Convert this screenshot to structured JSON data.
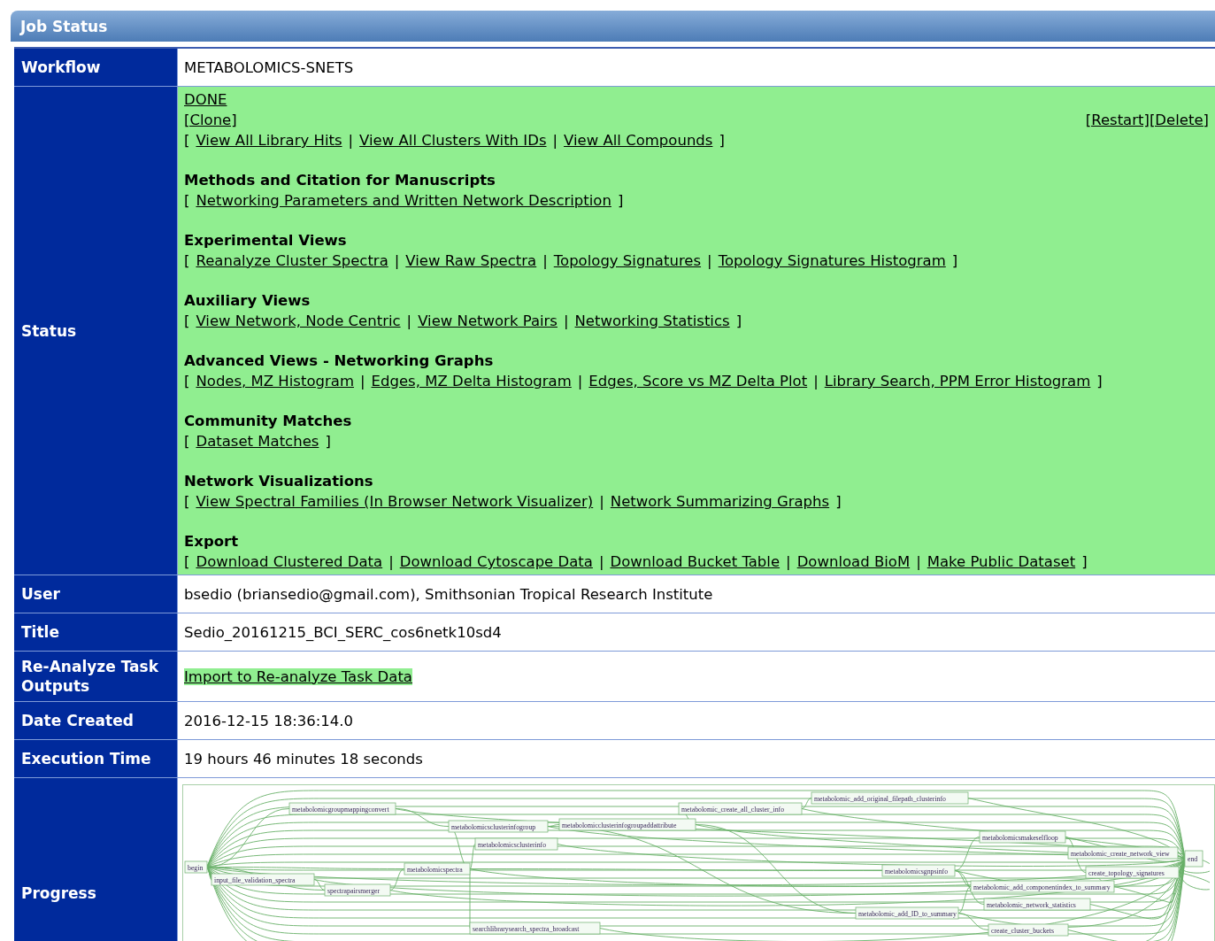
{
  "panel_title": "Job Status",
  "symbols": {
    "open": "[",
    "separator": "|",
    "close": "]"
  },
  "rows": [
    {
      "kind": "text",
      "label": "Workflow",
      "value": "METABOLOMICS-SNETS"
    },
    {
      "kind": "status",
      "label": "Status",
      "status_link": "DONE",
      "clone_link": "[Clone]",
      "actions": [
        "[Restart]",
        "[Delete]"
      ],
      "sections": [
        {
          "links": [
            "View All Library Hits",
            "View All Clusters With IDs",
            "View All Compounds"
          ]
        },
        {
          "heading": "Methods and Citation for Manuscripts",
          "links": [
            "Networking Parameters and Written Network Description"
          ]
        },
        {
          "heading": "Experimental Views",
          "links": [
            "Reanalyze Cluster Spectra",
            "View Raw Spectra",
            "Topology Signatures",
            "Topology Signatures Histogram"
          ]
        },
        {
          "heading": "Auxiliary Views",
          "links": [
            "View Network, Node Centric",
            "View Network Pairs",
            "Networking Statistics"
          ]
        },
        {
          "heading": "Advanced Views - Networking Graphs",
          "links": [
            "Nodes, MZ Histogram",
            "Edges, MZ Delta Histogram",
            "Edges, Score vs MZ Delta Plot",
            "Library Search, PPM Error Histogram"
          ]
        },
        {
          "heading": "Community Matches",
          "links": [
            "Dataset Matches"
          ]
        },
        {
          "heading": "Network Visualizations",
          "links": [
            "View Spectral Families (In Browser Network Visualizer)",
            "Network Summarizing Graphs"
          ]
        },
        {
          "heading": "Export",
          "links": [
            "Download Clustered Data",
            "Download Cytoscape Data",
            "Download Bucket Table",
            "Download BioM",
            "Make Public Dataset"
          ]
        }
      ]
    },
    {
      "kind": "text",
      "label": "User",
      "value": "bsedio (briansedio@gmail.com), Smithsonian Tropical Research Institute"
    },
    {
      "kind": "text",
      "label": "Title",
      "value": "Sedio_20161215_BCI_SERC_cos6netk10sd4"
    },
    {
      "kind": "link",
      "label": "Re-Analyze Task Outputs",
      "value": "Import to Re-analyze Task Data"
    },
    {
      "kind": "text",
      "label": "Date Created",
      "value": "2016-12-15 18:36:14.0"
    },
    {
      "kind": "text",
      "label": "Execution Time",
      "value": "19 hours 46 minutes 18 seconds"
    },
    {
      "kind": "graph",
      "label": "Progress",
      "nodes": [
        "begin",
        "input_file_validation_spectra",
        "metabolomicgroupmappingconvert",
        "metabolomicsclusterinfogroup",
        "metabolomicsclusterinfo",
        "metabolomicspectra",
        "spectrapairsmerger",
        "metabolomicclusterinfogroupaddattribute",
        "metabolomic_create_all_cluster_info",
        "metabolomic_add_original_filepath_clusterinfo",
        "searchlibrarysearch_spectra_broadcast",
        "metabolomicsmakeselfloop",
        "metabolomicsgnpsinfo",
        "metabolomic_create_network_view",
        "create_topology_signatures",
        "metabolomic_add_componentindex_to_summary",
        "metabolomic_network_statistics",
        "metabolomic_add_ID_to_summary",
        "create_cluster_buckets",
        "end"
      ]
    }
  ]
}
